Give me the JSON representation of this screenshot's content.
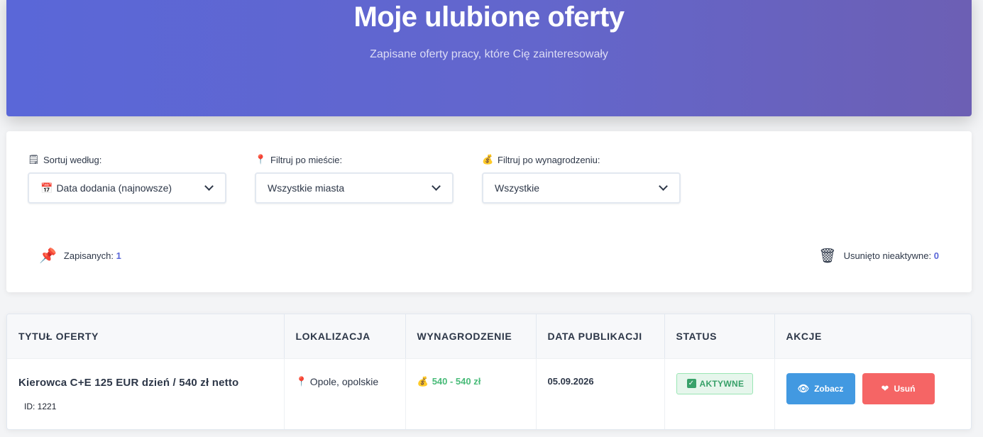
{
  "hero": {
    "title": "Moje ulubione oferty",
    "subtitle": "Zapisane oferty pracy, które Cię zainteresowały"
  },
  "filters": {
    "sort": {
      "icon": "document-icon",
      "label": "Sortuj według:",
      "value_icon": "calendar-icon",
      "value": "Data dodania (najnowsze)"
    },
    "city": {
      "icon": "pin-icon",
      "label": "Filtruj po mieście:",
      "value": "Wszystkie miasta"
    },
    "salary": {
      "icon": "money-bag-icon",
      "label": "Filtruj po wynagrodzeniu:",
      "value": "Wszystkie"
    }
  },
  "stats": {
    "saved_label": "Zapisanych:",
    "saved_count": "1",
    "removed_label": "Usunięto nieaktywne:",
    "removed_count": "0"
  },
  "table": {
    "headers": [
      "TYTUŁ OFERTY",
      "LOKALIZACJA",
      "WYNAGRODZENIE",
      "DATA PUBLIKACJI",
      "STATUS",
      "AKCJE"
    ],
    "rows": [
      {
        "title": "Kierowca C+E 125 EUR dzień / 540 zł netto",
        "id": "ID: 1221",
        "location": "Opole, opolskie",
        "salary": "540 - 540 zł",
        "date": "05.09.2026",
        "status": "AKTYWNE",
        "view_label": "Zobacz",
        "delete_label": "Usuń"
      }
    ]
  },
  "colors": {
    "accent": "#5a67d8",
    "status_active": "#38a169",
    "view_button": "#4299e1",
    "delete_button": "#f56565"
  }
}
